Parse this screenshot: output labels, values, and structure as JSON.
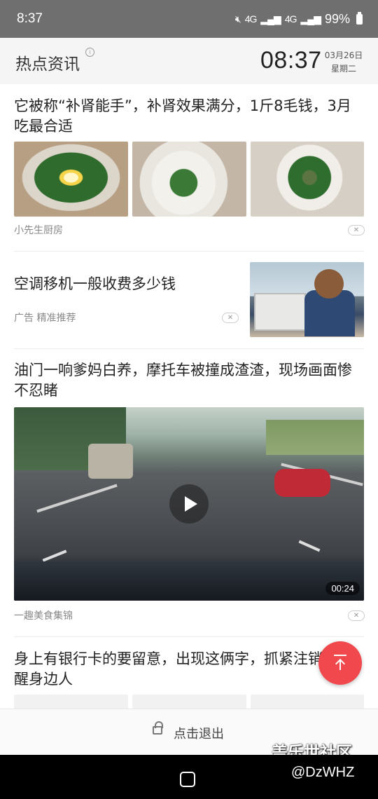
{
  "status_bar": {
    "time": "8:37",
    "signal_1": "4G",
    "signal_2": "4G",
    "battery": "99%",
    "mute_icon": "mute-icon",
    "battery_icon": "battery-icon"
  },
  "header": {
    "title": "热点资讯",
    "info_icon": "info-icon",
    "clock": "08:37",
    "date": "03月26日",
    "weekday": "星期二"
  },
  "feed": [
    {
      "type": "three-image",
      "title": "它被称“补肾能手”，补肾效果满分，1斤8毛钱，3月吃最合适",
      "source": "小先生厨房"
    },
    {
      "type": "ad",
      "title": "空调移机一般收费多少钱",
      "source": "广告 精准推荐"
    },
    {
      "type": "video",
      "title": "油门一响爹妈白养，摩托车被撞成渣渣，现场画面惨不忍睹",
      "duration": "00:24",
      "source": "一趣美食集锦"
    },
    {
      "type": "three-image",
      "title": "身上有银行卡的要留意，出现这俩字，抓紧注销，提醒身边人"
    }
  ],
  "close_glyph": "✕",
  "fab": {
    "icon": "back-to-top-icon"
  },
  "bottom": {
    "exit_label": "点击退出",
    "lock_icon": "unlock-icon"
  },
  "watermark": {
    "line1": "盖乐世社区",
    "line2": "@DzWHZ"
  },
  "nav": {
    "home_icon": "home-icon"
  }
}
